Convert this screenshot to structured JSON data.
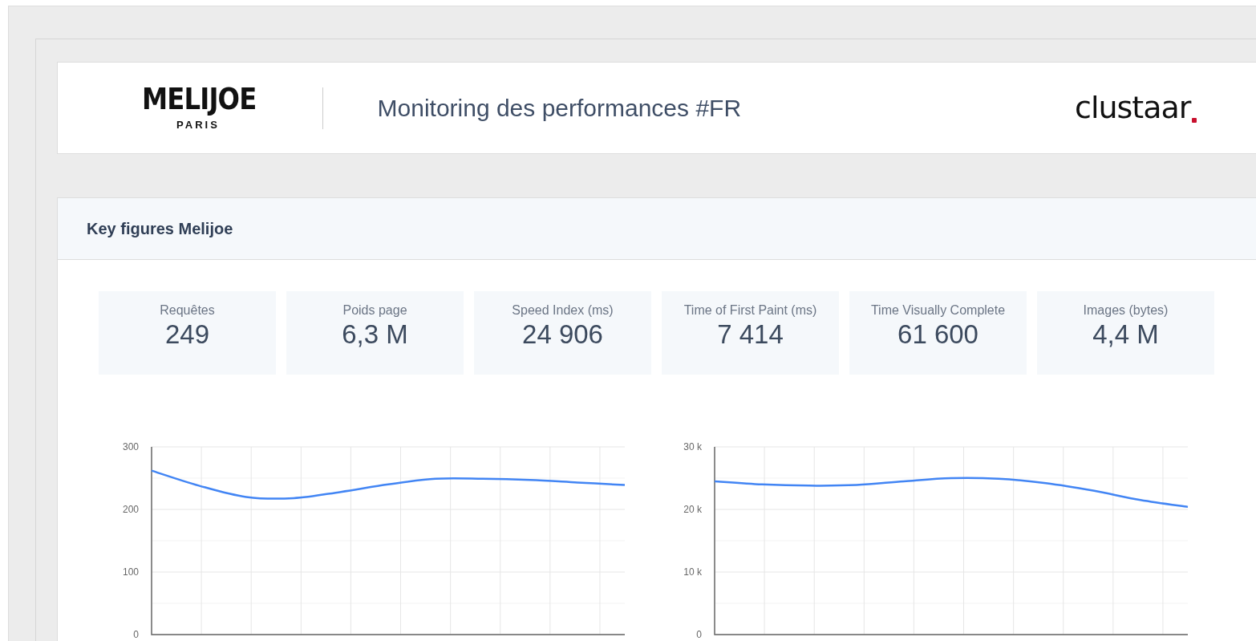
{
  "header": {
    "brand_logo": {
      "name": "MELIJOE",
      "subtitle": "PARIS"
    },
    "title": "Monitoring des performances #FR",
    "partner_logo": "clustaar"
  },
  "key_figures": {
    "title": "Key figures Melijoe",
    "stats": [
      {
        "label": "Requêtes",
        "value": "249"
      },
      {
        "label": "Poids page",
        "value": "6,3 M"
      },
      {
        "label": "Speed Index (ms)",
        "value": "24 906"
      },
      {
        "label": "Time of First Paint (ms)",
        "value": "7 414"
      },
      {
        "label": "Time Visually Complete",
        "value": "61 600"
      },
      {
        "label": "Images (bytes)",
        "value": "4,4 M"
      }
    ],
    "charts": [
      {
        "chart_data": {
          "type": "line",
          "ylim": [
            0,
            300
          ],
          "yticks": [
            0,
            100,
            200,
            300
          ],
          "series": [
            {
              "color": "#4285f4",
              "values": [
                262,
                238,
                220,
                218,
                228,
                240,
                249,
                249,
                247,
                243,
                239
              ]
            }
          ]
        }
      },
      {
        "chart_data": {
          "type": "line",
          "ylim": [
            0,
            30000
          ],
          "yticks": [
            {
              "value": 0,
              "label": "0"
            },
            {
              "value": 10000,
              "label": "10 k"
            },
            {
              "value": 20000,
              "label": "20 k"
            },
            {
              "value": 30000,
              "label": "30 k"
            }
          ],
          "series": [
            {
              "color": "#4285f4",
              "values": [
                24500,
                24000,
                23800,
                23900,
                24500,
                25000,
                24900,
                24200,
                23000,
                21500,
                20400
              ]
            }
          ]
        }
      }
    ]
  }
}
